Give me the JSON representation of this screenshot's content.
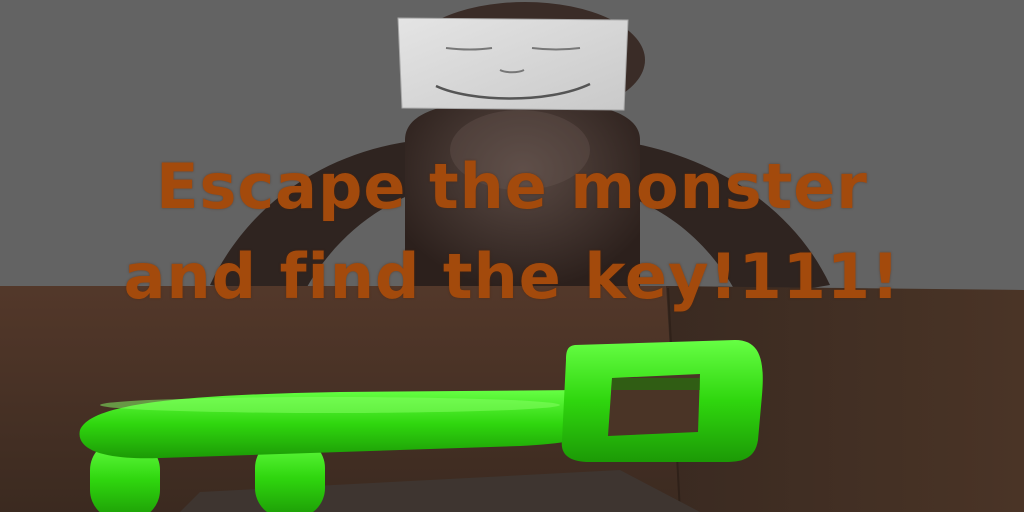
{
  "scene": {
    "headline_line1": "Escape the monster",
    "headline_line2": "and find the key!111!"
  },
  "colors": {
    "sky_wall": "#636363",
    "dirt_wall": "#4a3426",
    "monster_body": "#3a2a24",
    "paper_face": "#d8d8d8",
    "key_green": "#33dd11",
    "headline_text": "#a34a0c"
  }
}
